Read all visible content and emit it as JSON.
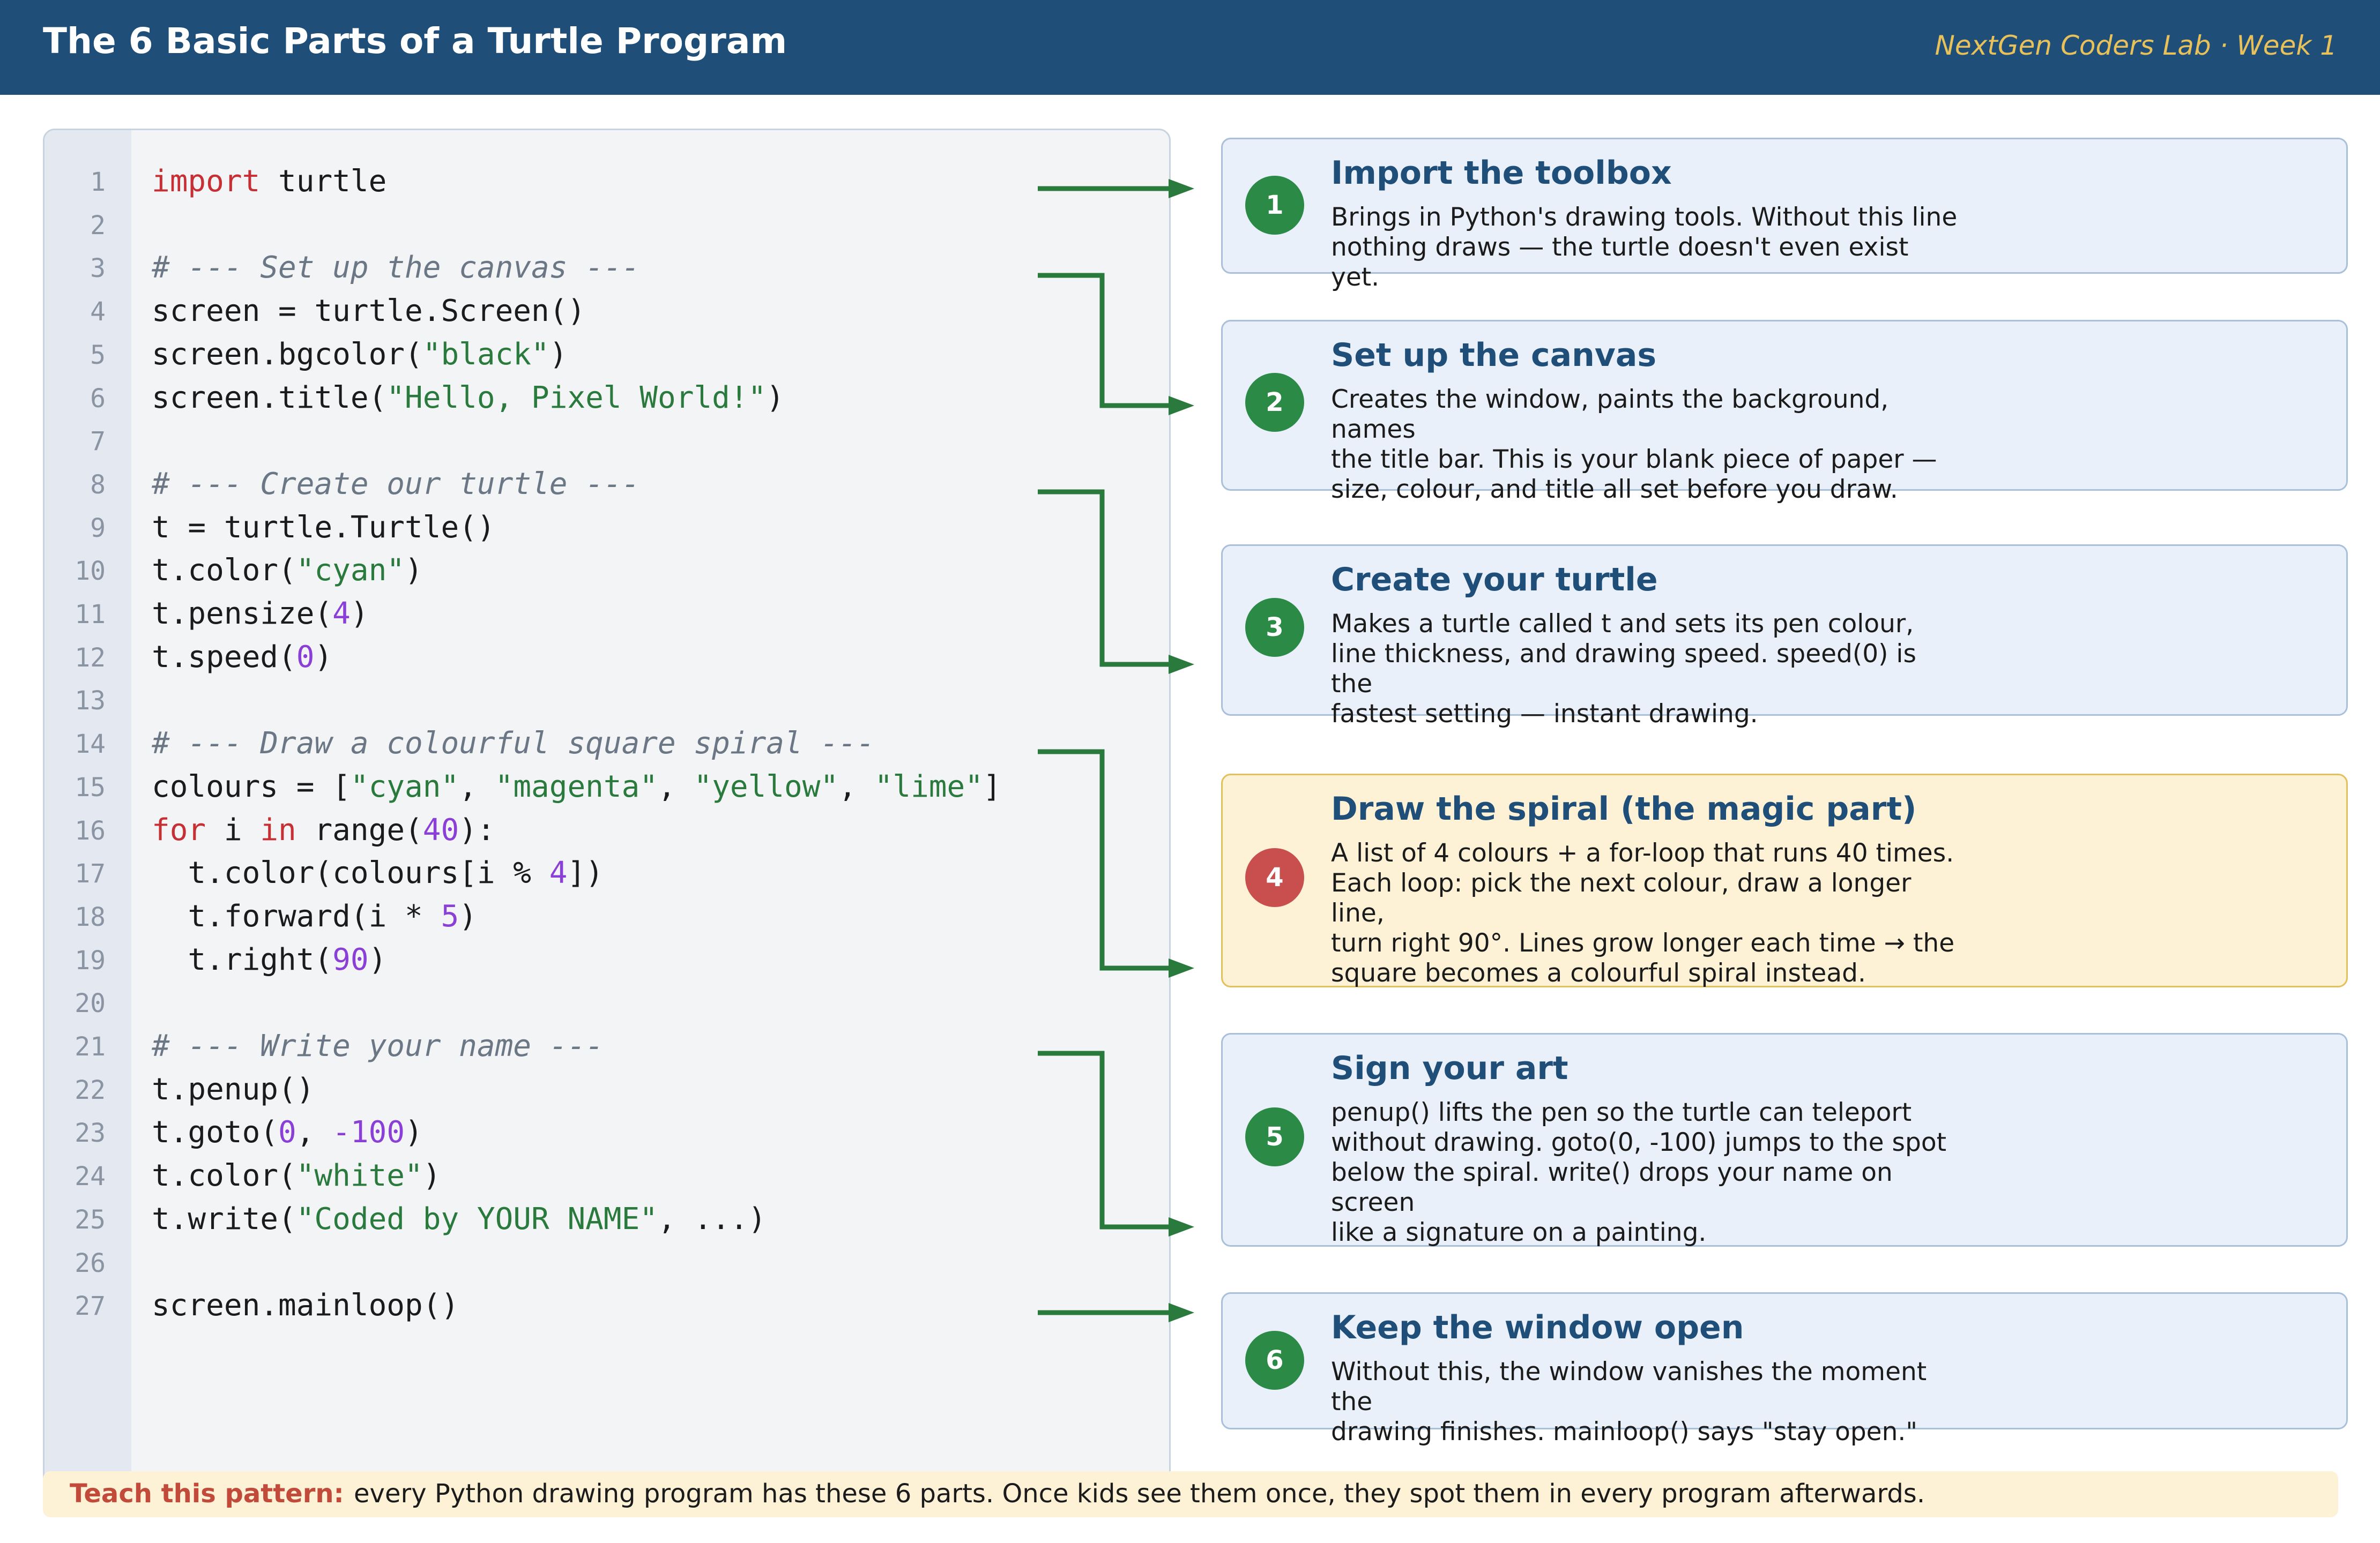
{
  "header": {
    "title": "The 6 Basic Parts of a Turtle Program",
    "subtitle": "NextGen Coders Lab · Week 1"
  },
  "code": {
    "line_numbers": [
      "1",
      "2",
      "3",
      "4",
      "5",
      "6",
      "7",
      "8",
      "9",
      "10",
      "11",
      "12",
      "13",
      "14",
      "15",
      "16",
      "17",
      "18",
      "19",
      "20",
      "21",
      "22",
      "23",
      "24",
      "25",
      "26",
      "27"
    ],
    "lines": {
      "l1": [
        {
          "t": "import",
          "c": "kw"
        },
        {
          "t": " turtle",
          "c": ""
        }
      ],
      "l3": [
        {
          "t": "# --- Set up the canvas ---",
          "c": "cm"
        }
      ],
      "l4": [
        {
          "t": "screen = turtle.Screen()",
          "c": ""
        }
      ],
      "l5": [
        {
          "t": "screen.bgcolor(",
          "c": ""
        },
        {
          "t": "\"black\"",
          "c": "str"
        },
        {
          "t": ")",
          "c": ""
        }
      ],
      "l6": [
        {
          "t": "screen.title(",
          "c": ""
        },
        {
          "t": "\"Hello, Pixel World!\"",
          "c": "str"
        },
        {
          "t": ")",
          "c": ""
        }
      ],
      "l8": [
        {
          "t": "# --- Create our turtle ---",
          "c": "cm"
        }
      ],
      "l9": [
        {
          "t": "t = turtle.Turtle()",
          "c": ""
        }
      ],
      "l10": [
        {
          "t": "t.color(",
          "c": ""
        },
        {
          "t": "\"cyan\"",
          "c": "str"
        },
        {
          "t": ")",
          "c": ""
        }
      ],
      "l11": [
        {
          "t": "t.pensize(",
          "c": ""
        },
        {
          "t": "4",
          "c": "num"
        },
        {
          "t": ")",
          "c": ""
        }
      ],
      "l12": [
        {
          "t": "t.speed(",
          "c": ""
        },
        {
          "t": "0",
          "c": "num"
        },
        {
          "t": ")",
          "c": ""
        }
      ],
      "l14": [
        {
          "t": "# --- Draw a colourful square spiral ---",
          "c": "cm"
        }
      ],
      "l15": [
        {
          "t": "colours = [",
          "c": ""
        },
        {
          "t": "\"cyan\"",
          "c": "str"
        },
        {
          "t": ", ",
          "c": ""
        },
        {
          "t": "\"magenta\"",
          "c": "str"
        },
        {
          "t": ", ",
          "c": ""
        },
        {
          "t": "\"yellow\"",
          "c": "str"
        },
        {
          "t": ", ",
          "c": ""
        },
        {
          "t": "\"lime\"",
          "c": "str"
        },
        {
          "t": "]",
          "c": ""
        }
      ],
      "l16": [
        {
          "t": "for",
          "c": "kw"
        },
        {
          "t": " i ",
          "c": ""
        },
        {
          "t": "in",
          "c": "kw"
        },
        {
          "t": " range(",
          "c": ""
        },
        {
          "t": "40",
          "c": "num"
        },
        {
          "t": "):",
          "c": ""
        }
      ],
      "l17": [
        {
          "t": "  t.color(colours[i % ",
          "c": ""
        },
        {
          "t": "4",
          "c": "num"
        },
        {
          "t": "])",
          "c": ""
        }
      ],
      "l18": [
        {
          "t": "  t.forward(i * ",
          "c": ""
        },
        {
          "t": "5",
          "c": "num"
        },
        {
          "t": ")",
          "c": ""
        }
      ],
      "l19": [
        {
          "t": "  t.right(",
          "c": ""
        },
        {
          "t": "90",
          "c": "num"
        },
        {
          "t": ")",
          "c": ""
        }
      ],
      "l21": [
        {
          "t": "# --- Write your name ---",
          "c": "cm"
        }
      ],
      "l22": [
        {
          "t": "t.penup()",
          "c": ""
        }
      ],
      "l23": [
        {
          "t": "t.goto(",
          "c": ""
        },
        {
          "t": "0",
          "c": "num"
        },
        {
          "t": ", ",
          "c": ""
        },
        {
          "t": "-100",
          "c": "num"
        },
        {
          "t": ")",
          "c": ""
        }
      ],
      "l24": [
        {
          "t": "t.color(",
          "c": ""
        },
        {
          "t": "\"white\"",
          "c": "str"
        },
        {
          "t": ")",
          "c": ""
        }
      ],
      "l25": [
        {
          "t": "t.write(",
          "c": ""
        },
        {
          "t": "\"Coded by YOUR NAME\"",
          "c": "str"
        },
        {
          "t": ", ...)",
          "c": ""
        }
      ],
      "l27": [
        {
          "t": "screen.mainloop()",
          "c": ""
        }
      ]
    }
  },
  "cards": [
    {
      "number": "1",
      "title": "Import the toolbox",
      "lines": [
        "Brings in Python's drawing tools. Without this line",
        "nothing draws — the turtle doesn't even exist yet."
      ]
    },
    {
      "number": "2",
      "title": "Set up the canvas",
      "lines": [
        "Creates the window, paints the background, names",
        "the title bar. This is your blank piece of paper —",
        "size, colour, and title all set before you draw."
      ]
    },
    {
      "number": "3",
      "title": "Create your turtle",
      "lines": [
        "Makes a turtle called t and sets its pen colour,",
        "line thickness, and drawing speed. speed(0) is the",
        "fastest setting — instant drawing."
      ]
    },
    {
      "number": "4",
      "title": "Draw the spiral (the magic part)",
      "lines": [
        "A list of 4 colours + a for-loop that runs 40 times.",
        "Each loop: pick the next colour, draw a longer line,",
        "turn right 90°. Lines grow longer each time → the",
        "square becomes a colourful spiral instead."
      ]
    },
    {
      "number": "5",
      "title": "Sign your art",
      "lines": [
        "penup() lifts the pen so the turtle can teleport",
        "without drawing. goto(0, -100) jumps to the spot",
        "below the spiral. write() drops your name on screen",
        "like a signature on a painting."
      ]
    },
    {
      "number": "6",
      "title": "Keep the window open",
      "lines": [
        "Without this, the window vanishes the moment the",
        "drawing finishes. mainloop() says \"stay open.\""
      ]
    }
  ],
  "footer": {
    "lead": "Teach this pattern:",
    "text": "every Python drawing program has these 6 parts. Once kids see them once, they spot them in every program afterwards."
  },
  "colors": {
    "header_bg": "#1f4e79",
    "accent_gold": "#e8c15a",
    "arrow_green": "#2a7a3d",
    "badge_green": "#2a8a46",
    "badge_red": "#c94f4f"
  }
}
